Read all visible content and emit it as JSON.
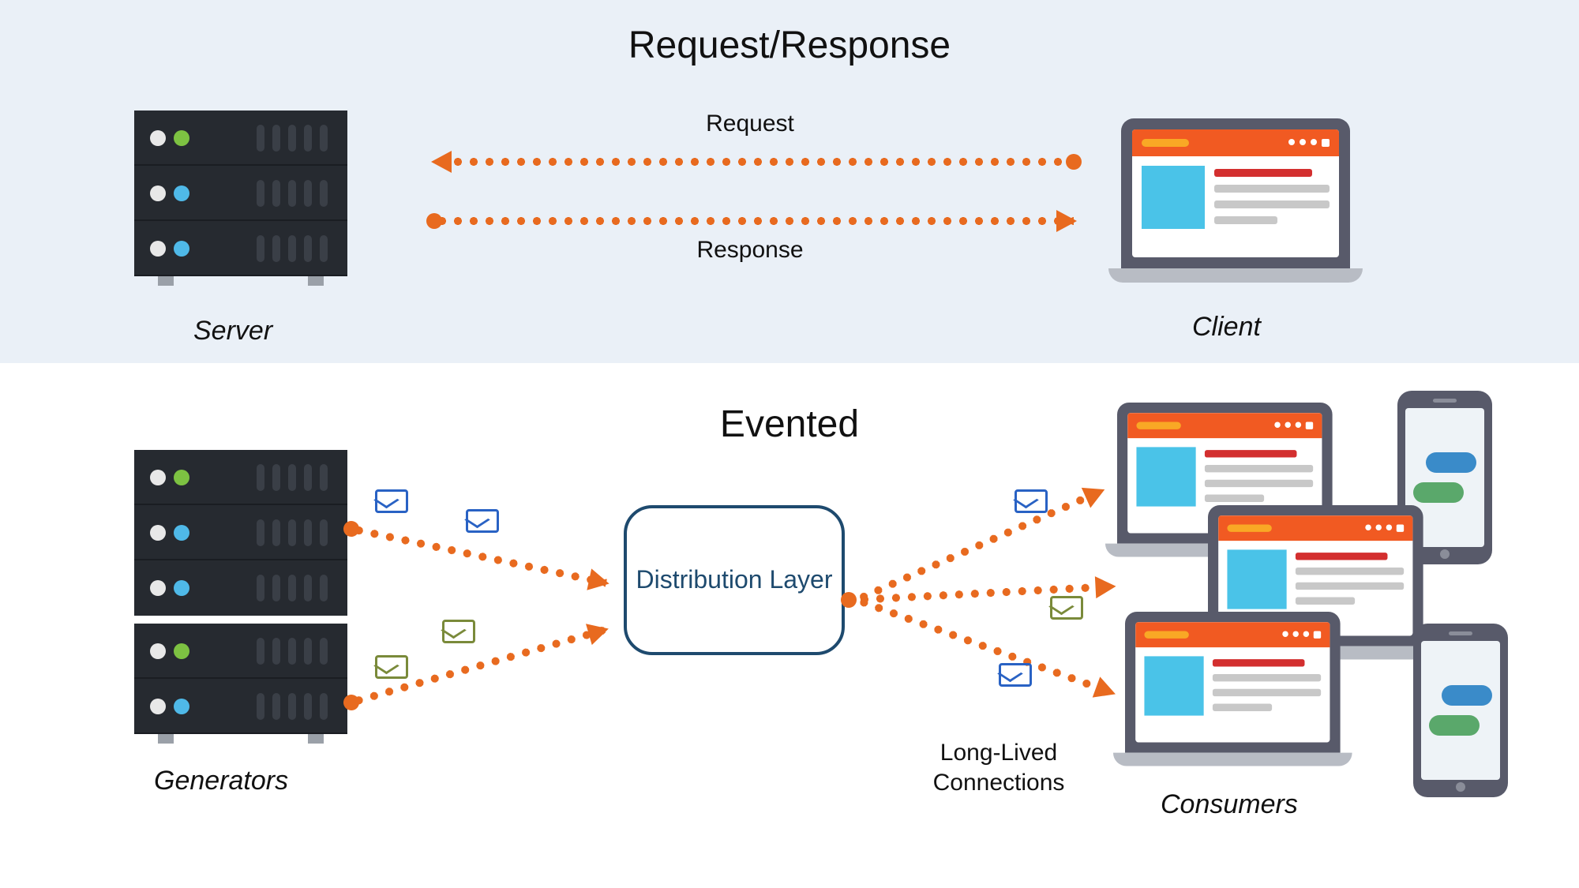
{
  "top": {
    "title": "Request/Response",
    "request_label": "Request",
    "response_label": "Response",
    "server_label": "Server",
    "client_label": "Client"
  },
  "bottom": {
    "title": "Evented",
    "generators_label": "Generators",
    "consumers_label": "Consumers",
    "distribution_label": "Distribution Layer",
    "longlived_label": "Long-Lived Connections"
  },
  "colors": {
    "arrow": "#e86a1f",
    "panel_bg": "#eaf0f7",
    "box_border": "#1e4a6e"
  }
}
